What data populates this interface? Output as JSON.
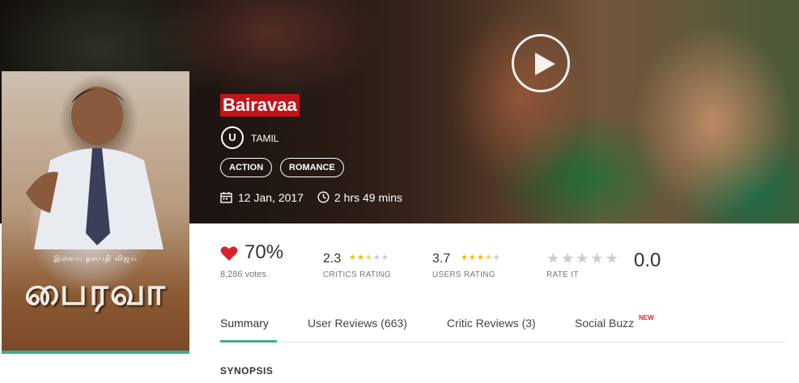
{
  "movie": {
    "title": "Bairavaa",
    "certificate": "U",
    "language": "TAMIL",
    "genres": [
      "ACTION",
      "ROMANCE"
    ],
    "release_date": "12 Jan, 2017",
    "duration": "2 hrs 49 mins"
  },
  "poster": {
    "credit_line": "இளைய தளபதி விஜய்",
    "title_text": "பைரவா"
  },
  "ratings": {
    "audience_percent": "70%",
    "votes": "8,286 votes",
    "critics": {
      "value": "2.3",
      "label": "CRITICS RATING",
      "stars_filled": 2.5
    },
    "users": {
      "value": "3.7",
      "label": "USERS RATING",
      "stars_filled": 3.5
    },
    "rate_it": {
      "value": "0.0",
      "label": "RATE IT"
    }
  },
  "tabs": [
    {
      "label": "Summary",
      "active": true
    },
    {
      "label": "User Reviews (663)",
      "active": false
    },
    {
      "label": "Critic Reviews (3)",
      "active": false
    },
    {
      "label": "Social Buzz",
      "active": false,
      "badge": "NEW"
    }
  ],
  "section": {
    "heading": "SYNOPSIS"
  },
  "icons": {
    "play": "play-icon",
    "heart": "heart-icon",
    "calendar": "calendar-icon",
    "clock": "clock-icon"
  },
  "colors": {
    "accent": "#3fae8a",
    "title_bg": "#c4121a",
    "heart": "#d7232a",
    "star": "#f5b800",
    "new_badge": "#e0262b"
  }
}
